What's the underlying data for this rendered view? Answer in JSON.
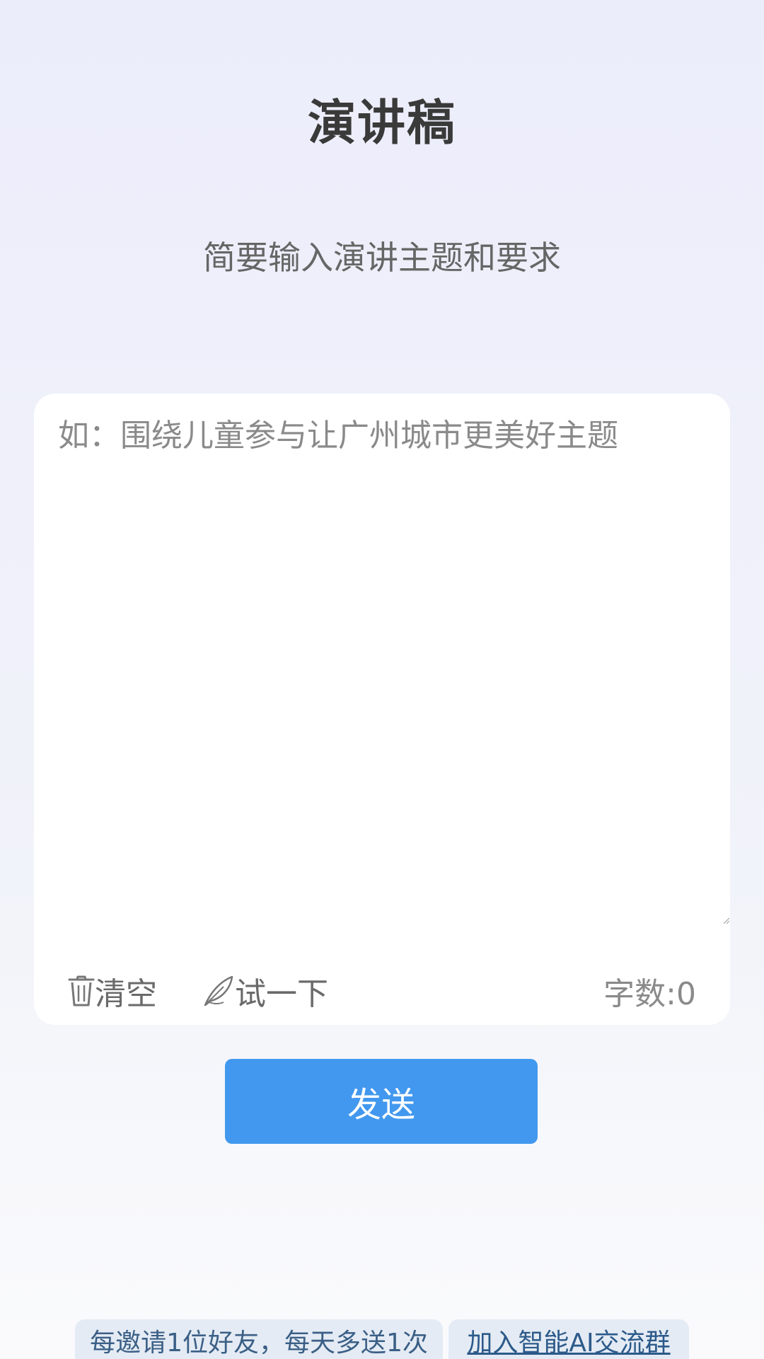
{
  "header": {
    "title": "演讲稿",
    "subtitle": "简要输入演讲主题和要求"
  },
  "editor": {
    "placeholder": "如：围绕儿童参与让广州城市更美好主题",
    "value": ""
  },
  "toolbar": {
    "clear_label": "清空",
    "try_label": "试一下",
    "word_count": "字数:0"
  },
  "actions": {
    "send_label": "发送"
  },
  "footer": {
    "invite_text": "每邀请1位好友，每天多送1次",
    "join_group_label": "加入智能AI交流群"
  },
  "colors": {
    "primary": "#4298EE",
    "background_top": "#ECEDFB",
    "background_bottom": "#FAFAFC",
    "card": "#FFFFFF",
    "banner": "#E4EBF4"
  },
  "icons": {
    "clear": "trash-icon",
    "try": "quill-icon"
  }
}
